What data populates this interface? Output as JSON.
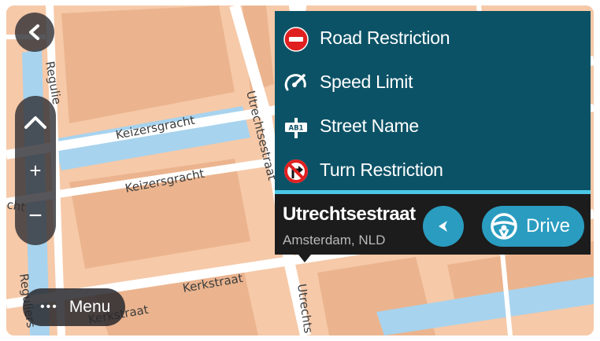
{
  "map": {
    "street_labels": [
      "Keizersgracht",
      "Keizersgracht",
      "Utrechtsestraat",
      "Utrechts",
      "Kerkstraat",
      "Kerkstraat",
      "Regulie",
      "Reguliers",
      "cht"
    ]
  },
  "controls": {
    "back_icon": "chevron-left-icon",
    "zoom_up_icon": "chevron-up-icon",
    "zoom_in": "+",
    "zoom_out": "−",
    "menu_dots": "•••",
    "menu_label": "Menu"
  },
  "popup": {
    "items": [
      {
        "label": "Road Restriction",
        "icon": "no-entry-icon"
      },
      {
        "label": "Speed Limit",
        "icon": "speedometer-icon"
      },
      {
        "label": "Street Name",
        "icon": "street-sign-icon",
        "icon_text": "AB1"
      },
      {
        "label": "Turn Restriction",
        "icon": "no-right-turn-icon"
      }
    ],
    "street": "Utrechtsestraat",
    "location": "Amsterdam, NLD",
    "drive_label": "Drive"
  },
  "colors": {
    "panel": "#0c5266",
    "accent": "#4bc8e8",
    "button": "#2a9cc0",
    "info_bar": "#1c1c1c",
    "water": "#a7d3ee",
    "building": "#ebb48e",
    "street": "#ffffff"
  }
}
